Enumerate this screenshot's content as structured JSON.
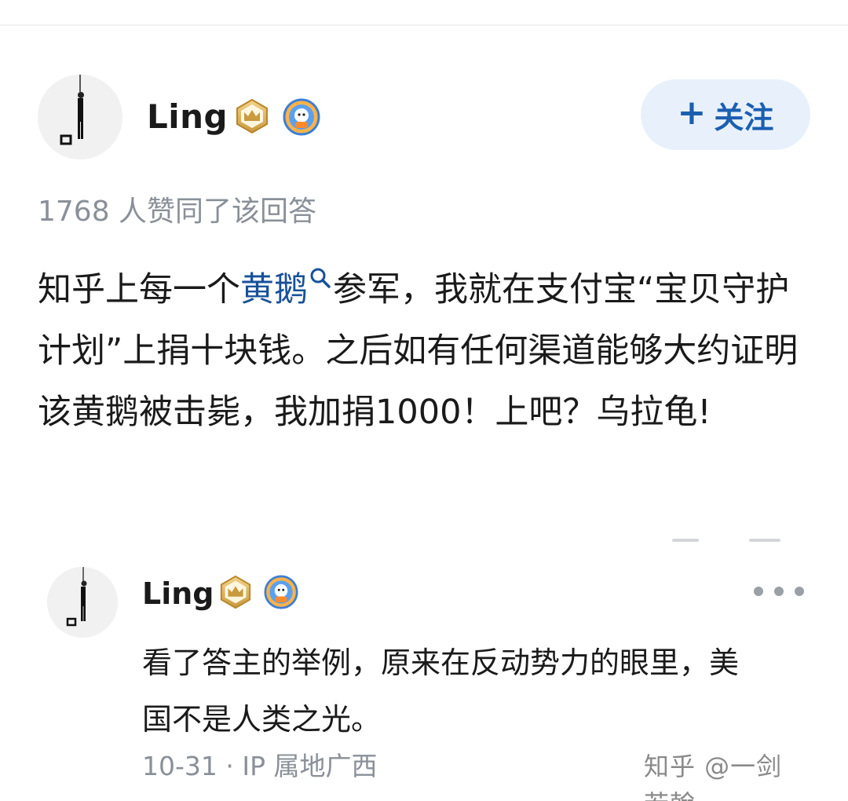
{
  "answer_header": {
    "author_name": "Ling",
    "follow_label": "关注",
    "follow_icon": "plus-icon"
  },
  "vote_line": "1768 人赞同了该回答",
  "answer": {
    "text_before": "知乎上每一个",
    "keyword": "黄鹅",
    "text_after": "参军，我就在支付宝“宝贝守护计划”上捐十块钱。之后如有任何渠道能够大约证明该黄鹅被击毙，我加捐1000！上吧？乌拉龟!"
  },
  "comment": {
    "author_name": "Ling",
    "text": "看了答主的举例，原来在反动势力的眼里，美国不是人类之光。",
    "meta": "10-31 · IP 属地广西"
  },
  "watermark": "知乎 @一剑若翰",
  "colors": {
    "link": "#175199",
    "follow_bg": "#e8f1fb",
    "follow_text": "#1b5fb0",
    "muted": "#8a9099"
  }
}
